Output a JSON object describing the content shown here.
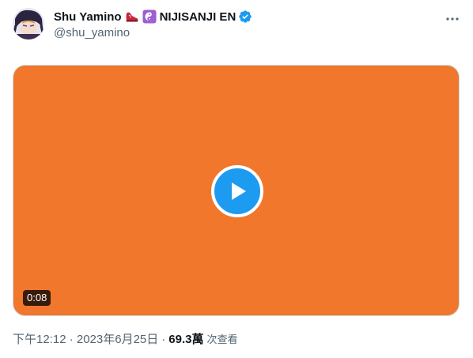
{
  "author": {
    "display_name": "Shu Yamino",
    "emoji_1": "shoe-emoji",
    "emoji_2": "yin-yang-emoji",
    "name_suffix": "NIJISANJI EN",
    "verified": true,
    "handle": "@shu_yamino"
  },
  "icons": {
    "more": "more-horizontal-icon",
    "verified": "verified-badge-icon",
    "play": "play-icon"
  },
  "video": {
    "duration": "0:08",
    "background_color": "#f1772d"
  },
  "meta": {
    "time": "下午12:12 · 2023年6月25日",
    "separator": "·",
    "views_count": "69.3萬",
    "views_label": "次查看"
  },
  "colors": {
    "accent": "#1d9bf0",
    "text_secondary": "#536471",
    "text_primary": "#0f1419"
  }
}
